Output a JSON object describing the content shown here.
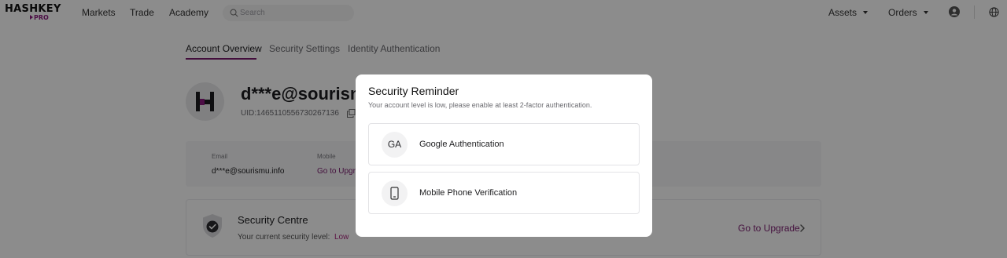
{
  "brand": {
    "logo_main": "HASHKEY",
    "logo_sub": "PRO"
  },
  "nav": {
    "links": [
      "Markets",
      "Trade",
      "Academy"
    ],
    "search_placeholder": "Search",
    "assets": "Assets",
    "orders": "Orders"
  },
  "tabs": [
    "Account Overview",
    "Security Settings",
    "Identity Authentication"
  ],
  "account": {
    "name": "d***e@sourism",
    "uid": "UID:1465110556730267136"
  },
  "info": {
    "email_label": "Email",
    "email_value": "d***e@sourismu.info",
    "mobile_label": "Mobile",
    "mobile_link": "Go to Upgra"
  },
  "security_centre": {
    "title": "Security Centre",
    "level_label": "Your current security level:",
    "level_value": "Low",
    "upgrade": "Go to Upgrade"
  },
  "modal": {
    "title": "Security Reminder",
    "description": "Your account level is low, please enable at least 2-factor authentication.",
    "options": [
      {
        "icon_text": "GA",
        "label": "Google Authentication",
        "icon": "google-authenticator-icon"
      },
      {
        "label": "Mobile Phone Verification",
        "icon": "mobile-phone-icon"
      }
    ]
  },
  "colors": {
    "accent": "#7a1b6e",
    "low_level": "#a8267e",
    "overlay": "rgba(0,0,0,0.45)"
  }
}
